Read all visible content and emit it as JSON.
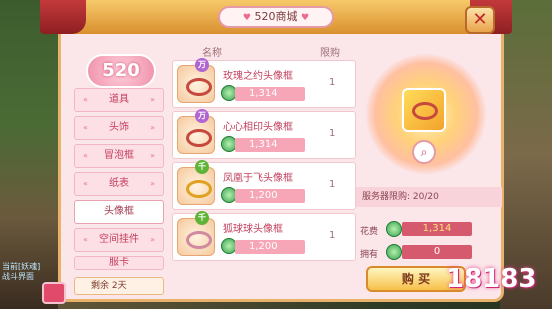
{
  "window": {
    "title": "520商城",
    "badge": "520",
    "close": "✕"
  },
  "categories": [
    {
      "label": "道具",
      "active": false
    },
    {
      "label": "头饰",
      "active": false
    },
    {
      "label": "冒泡框",
      "active": false
    },
    {
      "label": "纸表",
      "active": false
    },
    {
      "label": "头像框",
      "active": true
    },
    {
      "label": "空间挂件",
      "active": false
    },
    {
      "label": "服卡",
      "active": false
    }
  ],
  "remaining": {
    "label": "剩余",
    "value": "2天"
  },
  "list_header": {
    "name": "名称",
    "limit": "限购"
  },
  "items": [
    {
      "tag": "万",
      "tag_color": "purple",
      "name": "玫瑰之约头像框",
      "price": "1,314",
      "limit": "1"
    },
    {
      "tag": "万",
      "tag_color": "purple",
      "name": "心心相印头像框",
      "price": "1,314",
      "limit": "1"
    },
    {
      "tag": "千",
      "tag_color": "green",
      "name": "凤凰于飞头像框",
      "price": "1,200",
      "limit": "1"
    },
    {
      "tag": "千",
      "tag_color": "green",
      "name": "狐球球头像框",
      "price": "1,200",
      "limit": "1"
    }
  ],
  "detail": {
    "server_limit_label": "服务器限购:",
    "server_limit_value": "20/20",
    "cost_label": "花费",
    "cost_value": "1,314",
    "owned_label": "拥有",
    "owned_value": "0",
    "buy_label": "购 买"
  },
  "side_texts": [
    "当前[妖魂]",
    "战斗界面"
  ],
  "logo": "18183",
  "colors": {
    "accent": "#c2405e",
    "panel": "#fbe6ea",
    "gold": "#f7c04a"
  },
  "icons": [
    "close-icon",
    "coin-icon",
    "zoom-icon",
    "gift-icon",
    "avatar-frame-icon"
  ]
}
